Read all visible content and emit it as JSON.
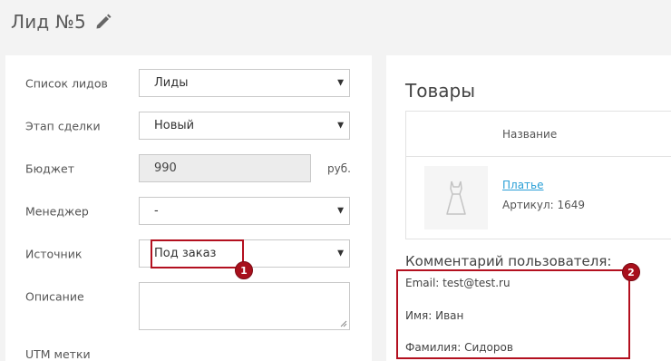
{
  "header": {
    "title": "Лид №5"
  },
  "form": {
    "lead_list": {
      "label": "Список лидов",
      "value": "Лиды"
    },
    "deal_stage": {
      "label": "Этап сделки",
      "value": "Новый"
    },
    "budget": {
      "label": "Бюджет",
      "value": "990",
      "currency": "руб."
    },
    "manager": {
      "label": "Менеджер",
      "value": "-"
    },
    "source": {
      "label": "Источник",
      "value": "Под заказ"
    },
    "description": {
      "label": "Описание",
      "value": ""
    },
    "utm": {
      "label": "UTM метки"
    }
  },
  "goods": {
    "title": "Товары",
    "column_name": "Название",
    "items": [
      {
        "name": "Платье",
        "sku": "Артикул: 1649"
      }
    ]
  },
  "comment": {
    "title": "Комментарий пользователя:",
    "lines": [
      "Email: test@test.ru",
      "Имя: Иван",
      "Фамилия: Сидоров"
    ]
  },
  "markers": [
    "1",
    "2"
  ],
  "colors": {
    "highlight": "#b3101f",
    "link": "#2a9fd6",
    "background": "#f3f3f3"
  }
}
